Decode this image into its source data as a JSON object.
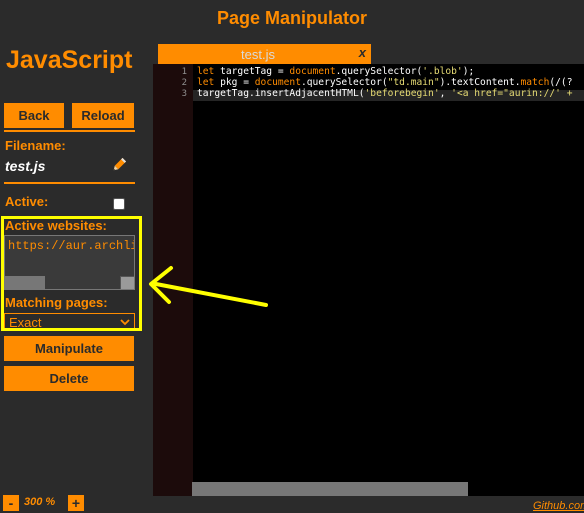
{
  "header": {
    "title": "Page Manipulator"
  },
  "sidebar": {
    "title": "JavaScript",
    "back_label": "Back",
    "reload_label": "Reload",
    "filename_label": "Filename:",
    "filename_value": "test.js",
    "active_label": "Active:",
    "active_checked": false,
    "active_websites_label": "Active websites:",
    "active_websites_value": "https://aur.archli",
    "matching_pages_label": "Matching pages:",
    "matching_pages_selected": "Exact",
    "manipulate_label": "Manipulate",
    "delete_label": "Delete"
  },
  "zoom": {
    "minus": "-",
    "value": "300 %",
    "plus": "+"
  },
  "editor": {
    "tab_label": "test.js",
    "tab_close": "x",
    "line_numbers": [
      "1",
      "2",
      "3"
    ],
    "active_line": 3
  },
  "footer": {
    "github_label": "Github.com"
  },
  "colors": {
    "accent": "#ff8c00",
    "background": "#2b2b2b",
    "annotation": "#ffff00"
  },
  "icons": [
    "pencil-icon",
    "chevron-down-icon",
    "arrow-annotation"
  ]
}
